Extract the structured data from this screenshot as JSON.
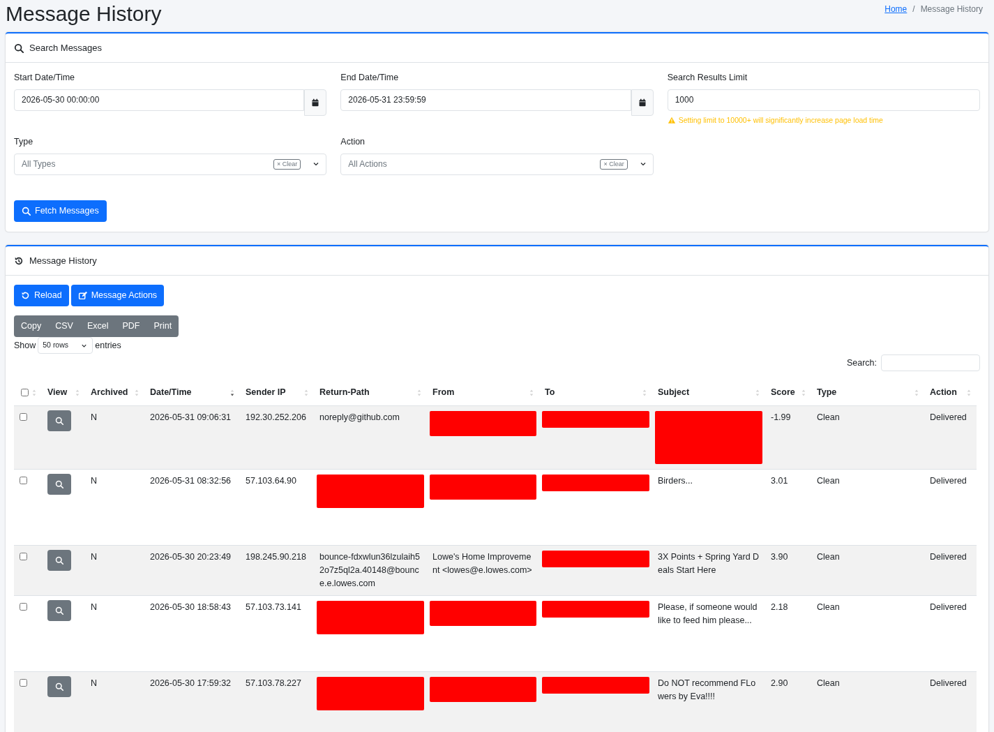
{
  "page_title": "Message History",
  "breadcrumb": [
    {
      "label": "Home",
      "link": true
    },
    {
      "label": "Message History",
      "link": false
    }
  ],
  "breadcrumb_separator": "/",
  "search_card": {
    "title": "Search Messages",
    "fields": [
      {
        "kind": "date",
        "label": "Start Date/Time",
        "value": "2026-05-30 00:00:00"
      },
      {
        "kind": "date",
        "label": "End Date/Time",
        "value": "2026-05-31 23:59:59"
      },
      {
        "kind": "text",
        "label": "Search Results Limit",
        "value": "1000",
        "warning": "Setting limit to 10000+ will significantly increase page load time"
      },
      {
        "kind": "select",
        "label": "Type",
        "placeholder": "All Types",
        "clear": "× Clear"
      },
      {
        "kind": "select",
        "label": "Action",
        "placeholder": "All Actions",
        "clear": "× Clear"
      }
    ],
    "button": "Fetch Messages"
  },
  "history_card": {
    "title": "Message History",
    "buttons": [
      {
        "kind": "reload",
        "label": "Reload"
      },
      {
        "kind": "edit",
        "label": "Message Actions"
      }
    ],
    "export_buttons": [
      "Copy",
      "CSV",
      "Excel",
      "PDF",
      "Print"
    ],
    "length": {
      "before": "Show",
      "value": "50 rows",
      "after": "entries"
    },
    "search_label": "Search:",
    "table": {
      "columns": [
        {
          "kind": "check",
          "checked": false,
          "sorted": false
        },
        {
          "label": "View",
          "sorted": false
        },
        {
          "label": "Archived",
          "sorted": false
        },
        {
          "label": "Date/Time",
          "sorted": true
        },
        {
          "label": "Sender IP",
          "sorted": false
        },
        {
          "label": "Return-Path",
          "sorted": false
        },
        {
          "label": "From",
          "sorted": false
        },
        {
          "label": "To",
          "sorted": false
        },
        {
          "label": "Subject",
          "sorted": false
        },
        {
          "label": "Score",
          "sorted": false
        },
        {
          "label": "Type",
          "sorted": false
        },
        {
          "label": "Action",
          "sorted": false
        }
      ],
      "rows": [
        {
          "checked": false,
          "archived": "N",
          "datetime": "2026-05-31 09:06:31",
          "sender_ip": "192.30.252.206",
          "return_path": {
            "text": "noreply@github.com"
          },
          "from": {
            "redacted": true
          },
          "to": {
            "redacted": true
          },
          "subject": {
            "redacted": true
          },
          "score": "-1.99",
          "type": "Clean",
          "action": "Delivered"
        },
        {
          "checked": false,
          "archived": "N",
          "datetime": "2026-05-31 08:32:56",
          "sender_ip": "57.103.64.90",
          "return_path": {
            "redacted": true
          },
          "from": {
            "redacted": true
          },
          "to": {
            "redacted": true
          },
          "subject": {
            "text": "Birders..."
          },
          "score": "3.01",
          "type": "Clean",
          "action": "Delivered"
        },
        {
          "checked": false,
          "archived": "N",
          "datetime": "2026-05-30 20:23:49",
          "sender_ip": "198.245.90.218",
          "return_path": {
            "text": "bounce-fdxwlun36lzulaih52o7z5ql2a.40148@bounce.e.lowes.com"
          },
          "from": {
            "text": "Lowe's Home Improvement <lowes@e.lowes.com>"
          },
          "to": {
            "redacted": true
          },
          "subject": {
            "text": "3X Points + Spring Yard Deals Start Here"
          },
          "score": "3.90",
          "type": "Clean",
          "action": "Delivered"
        },
        {
          "checked": false,
          "archived": "N",
          "datetime": "2026-05-30 18:58:43",
          "sender_ip": "57.103.73.141",
          "return_path": {
            "redacted": true
          },
          "from": {
            "redacted": true
          },
          "to": {
            "redacted": true
          },
          "subject": {
            "text": "Please, if someone would like to feed him please..."
          },
          "score": "2.18",
          "type": "Clean",
          "action": "Delivered"
        },
        {
          "checked": false,
          "archived": "N",
          "datetime": "2026-05-30 17:59:32",
          "sender_ip": "57.103.78.227",
          "return_path": {
            "redacted": true
          },
          "from": {
            "redacted": true
          },
          "to": {
            "redacted": true
          },
          "subject": {
            "text": "Do NOT recommend FLowers by Eva!!!!"
          },
          "score": "2.90",
          "type": "Clean",
          "action": "Delivered"
        }
      ]
    }
  }
}
